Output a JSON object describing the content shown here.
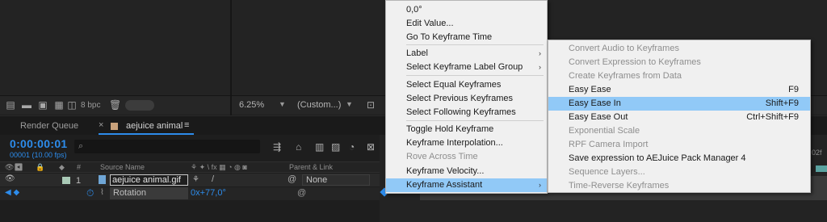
{
  "viewer": {
    "bpc": "8 bpc",
    "zoom": "6.25%",
    "quality": "(Custom...)"
  },
  "tabs": {
    "render_queue": "Render Queue",
    "comp_name": "aejuice animal",
    "close": "×",
    "menu": "≡"
  },
  "timeline": {
    "timecode": "0:00:00:01",
    "fps": "00001 (10.00 fps)",
    "search_icon": "⌕",
    "marker_02f": "02f"
  },
  "headers": {
    "num": "#",
    "source_name": "Source Name",
    "parent_link": "Parent & Link"
  },
  "layer": {
    "number": "1",
    "name": "aejuice animal.gif",
    "parent": "None",
    "property": "Rotation",
    "value": "0x+77,0°"
  },
  "context_menu": {
    "items": [
      {
        "label": "0,0°"
      },
      {
        "label": "Edit Value..."
      },
      {
        "label": "Go To Keyframe Time"
      },
      {
        "label": "Label",
        "submenu": true
      },
      {
        "label": "Select Keyframe Label Group",
        "submenu": true
      },
      {
        "label": "Select Equal Keyframes"
      },
      {
        "label": "Select Previous Keyframes"
      },
      {
        "label": "Select Following Keyframes"
      },
      {
        "label": "Toggle Hold Keyframe"
      },
      {
        "label": "Keyframe Interpolation..."
      },
      {
        "label": "Rove Across Time",
        "disabled": true
      },
      {
        "label": "Keyframe Velocity..."
      },
      {
        "label": "Keyframe Assistant",
        "submenu": true,
        "highlighted": true
      }
    ],
    "arrow": "›"
  },
  "submenu": {
    "items": [
      {
        "label": "Convert Audio to Keyframes",
        "disabled": true
      },
      {
        "label": "Convert Expression to Keyframes",
        "disabled": true
      },
      {
        "label": "Create Keyframes from Data",
        "disabled": true
      },
      {
        "label": "Easy Ease",
        "shortcut": "F9"
      },
      {
        "label": "Easy Ease In",
        "shortcut": "Shift+F9",
        "highlighted": true
      },
      {
        "label": "Easy Ease Out",
        "shortcut": "Ctrl+Shift+F9"
      },
      {
        "label": "Exponential Scale",
        "disabled": true
      },
      {
        "label": "RPF Camera Import",
        "disabled": true
      },
      {
        "label": "Save expression to AEJuice Pack Manager 4"
      },
      {
        "label": "Sequence Layers...",
        "disabled": true
      },
      {
        "label": "Time-Reverse Keyframes",
        "disabled": true
      }
    ]
  },
  "colors": {
    "accent": "#2d8ceb",
    "menu_bg": "#f0f0f0",
    "menu_highlight": "#91c9f7",
    "label_swatch": "#c8a17b"
  }
}
